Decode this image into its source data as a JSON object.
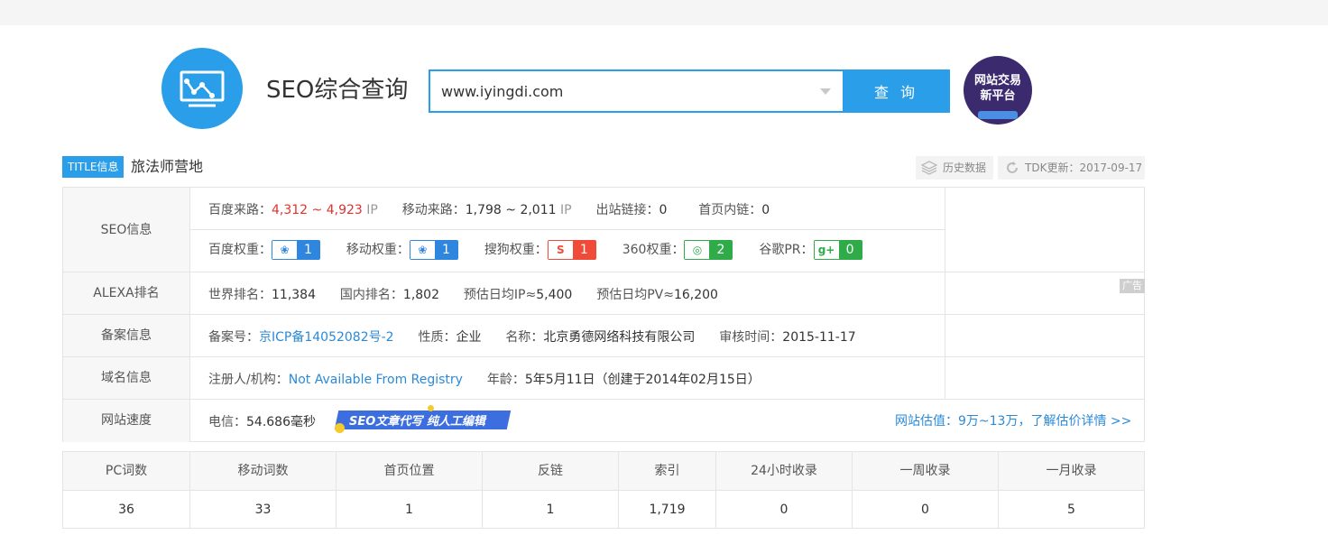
{
  "header": {
    "brand": "SEO综合查询",
    "search_value": "www.iyingdi.com",
    "search_button": "查 询",
    "trade_badge_line1": "网站交易",
    "trade_badge_line2": "新平台"
  },
  "title_info": {
    "tag": "TITLE信息",
    "value": "旅法师营地",
    "history_label": "历史数据",
    "tdk_label": "TDK更新：2017-09-17"
  },
  "seo": {
    "label": "SEO信息",
    "baidu_traffic_label": "百度来路：",
    "baidu_traffic_value": "4,312 ~ 4,923",
    "ip_unit": "IP",
    "mobile_traffic_label": "移动来路：",
    "mobile_traffic_value": "1,798 ~ 2,011",
    "outbound_label": "出站链接：",
    "outbound_value": "0",
    "internal_label": "首页内链：",
    "internal_value": "0",
    "weights": [
      {
        "label": "百度权重：",
        "value": "1"
      },
      {
        "label": "移动权重：",
        "value": "1"
      },
      {
        "label": "搜狗权重：",
        "value": "1"
      },
      {
        "label": "360权重：",
        "value": "2"
      },
      {
        "label": "谷歌PR：",
        "value": "0"
      }
    ],
    "ad_label": "广告"
  },
  "alexa": {
    "label": "ALEXA排名",
    "world_label": "世界排名：",
    "world_value": "11,384",
    "domestic_label": "国内排名：",
    "domestic_value": "1,802",
    "ip_label": "预估日均IP≈",
    "ip_value": "5,400",
    "pv_label": "预估日均PV≈",
    "pv_value": "16,200"
  },
  "icp": {
    "label": "备案信息",
    "number_label": "备案号：",
    "number_value": "京ICP备14052082号-2",
    "nature_label": "性质：",
    "nature_value": "企业",
    "name_label": "名称：",
    "name_value": "北京勇德网络科技有限公司",
    "review_label": "审核时间：",
    "review_value": "2015-11-17"
  },
  "domain": {
    "label": "域名信息",
    "registrant_label": "注册人/机构：",
    "registrant_value": "Not Available From Registry",
    "age_label": "年龄：",
    "age_value": "5年5月11日（创建于2014年02月15日）"
  },
  "speed": {
    "label": "网站速度",
    "telecom_label": "电信：",
    "telecom_value": "54.686毫秒",
    "ad_text": "SEO文章代写  纯人工编辑",
    "estimate_link": "网站估值：9万~13万，了解估价详情 >>"
  },
  "stats": {
    "headers": [
      "PC词数",
      "移动词数",
      "首页位置",
      "反链",
      "索引",
      "24小时收录",
      "一周收录",
      "一月收录"
    ],
    "values": [
      "36",
      "33",
      "1",
      "1",
      "1,719",
      "0",
      "0",
      "5"
    ]
  }
}
